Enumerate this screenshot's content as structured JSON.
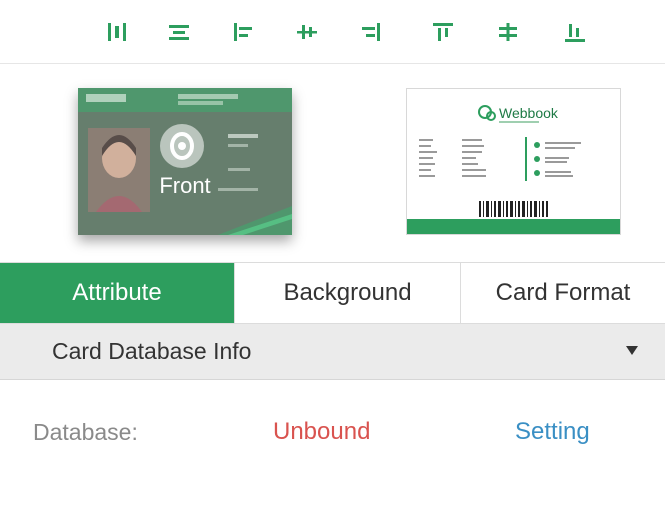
{
  "toolbar": {
    "icons": [
      {
        "name": "distribute-horizontal-icon"
      },
      {
        "name": "align-center-horizontal-icon"
      },
      {
        "name": "align-left-icon"
      },
      {
        "name": "align-center-vertical-icon"
      },
      {
        "name": "align-right-icon"
      },
      {
        "name": "align-top-icon"
      },
      {
        "name": "align-middle-icon"
      },
      {
        "name": "align-bottom-icon"
      }
    ],
    "accent": "#2d9e5e"
  },
  "previews": {
    "front_label": "Front",
    "back_brand": "Webbook"
  },
  "tabs": [
    {
      "label": "Attribute",
      "active": true
    },
    {
      "label": "Background",
      "active": false
    },
    {
      "label": "Card Format",
      "active": false
    }
  ],
  "section": {
    "title": "Card Database Info"
  },
  "database": {
    "label": "Database:",
    "status": "Unbound",
    "setting": "Setting"
  },
  "colors": {
    "accent": "#2d9e5e",
    "status_unbound": "#d9534f",
    "link": "#3a8fc4"
  }
}
